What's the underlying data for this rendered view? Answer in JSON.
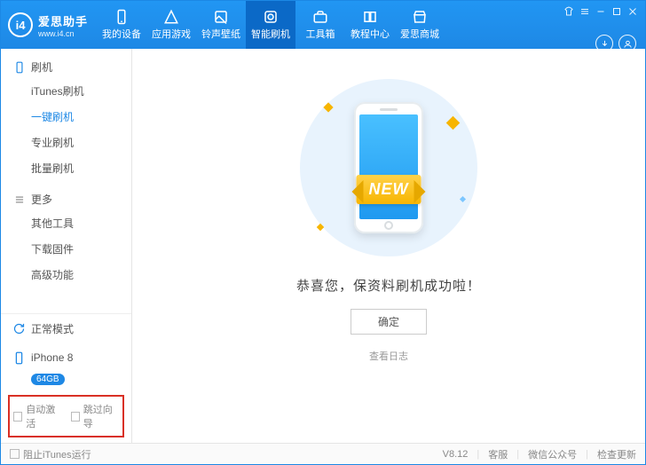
{
  "logo": {
    "initials": "i4",
    "title": "爱思助手",
    "subtitle": "www.i4.cn"
  },
  "nav": {
    "items": [
      {
        "label": "我的设备"
      },
      {
        "label": "应用游戏"
      },
      {
        "label": "铃声壁纸"
      },
      {
        "label": "智能刷机"
      },
      {
        "label": "工具箱"
      },
      {
        "label": "教程中心"
      },
      {
        "label": "爱思商城"
      }
    ],
    "activeIndex": 3
  },
  "sidebar": {
    "group1": {
      "label": "刷机",
      "items": [
        {
          "label": "iTunes刷机"
        },
        {
          "label": "一键刷机"
        },
        {
          "label": "专业刷机"
        },
        {
          "label": "批量刷机"
        }
      ],
      "selectedIndex": 1
    },
    "group2": {
      "label": "更多",
      "items": [
        {
          "label": "其他工具"
        },
        {
          "label": "下载固件"
        },
        {
          "label": "高级功能"
        }
      ]
    },
    "mode": {
      "label": "正常模式"
    },
    "device": {
      "name": "iPhone 8",
      "capacity": "64GB"
    },
    "options": {
      "autoActivate": "自动激活",
      "skipGuide": "跳过向导"
    }
  },
  "main": {
    "ribbon": "NEW",
    "message": "恭喜您，保资料刷机成功啦！",
    "ok": "确定",
    "logLink": "查看日志"
  },
  "footer": {
    "blockItunes": "阻止iTunes运行",
    "version": "V8.12",
    "support": "客服",
    "wechat": "微信公众号",
    "update": "检查更新"
  }
}
